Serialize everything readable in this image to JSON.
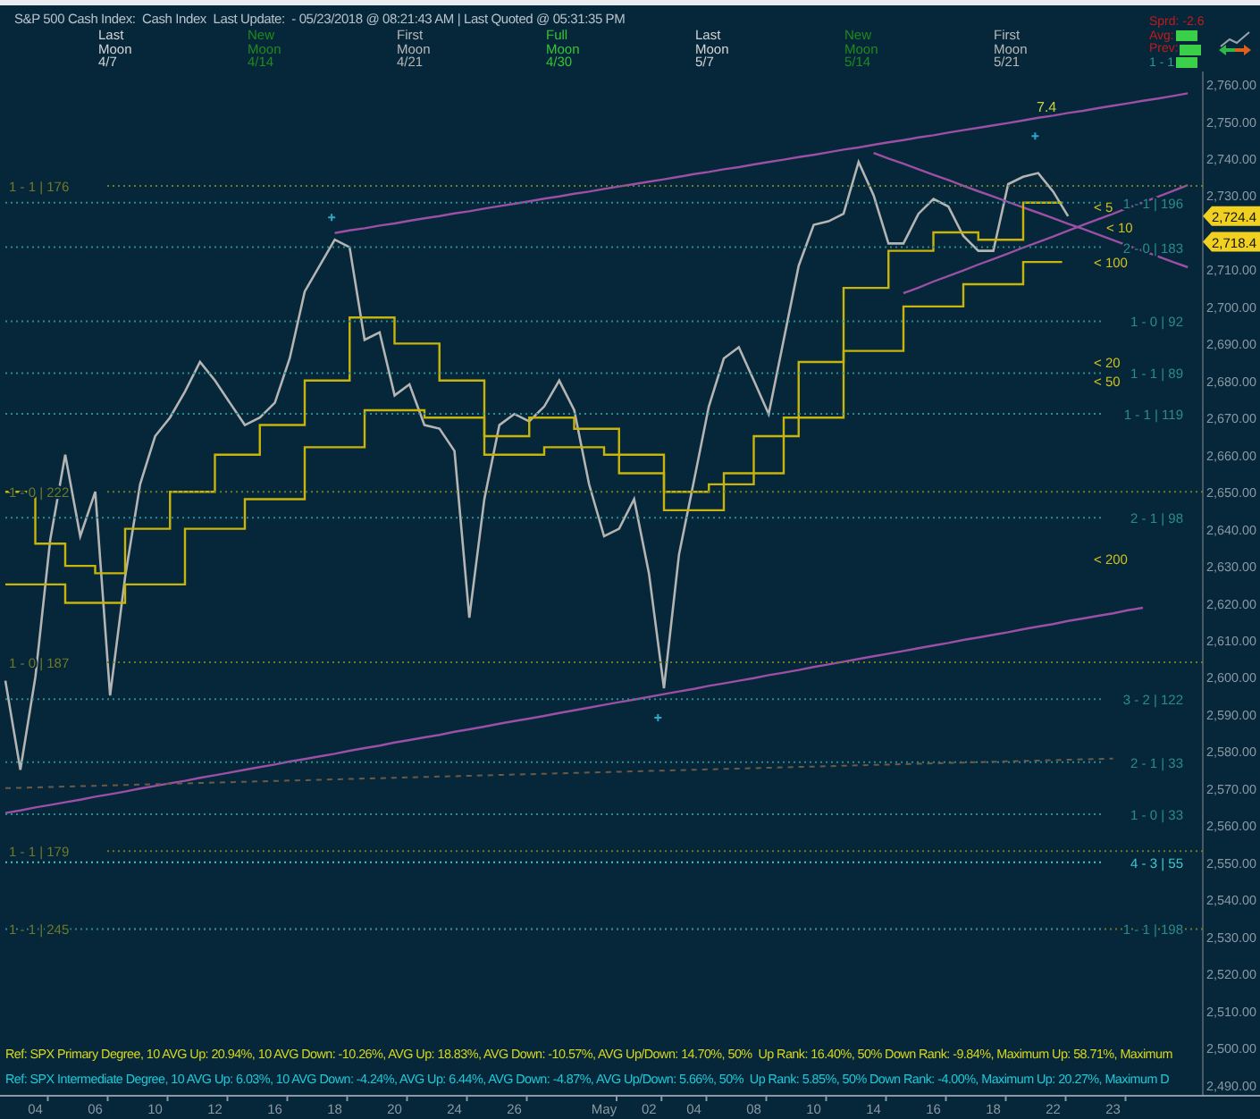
{
  "header": {
    "title": "S&P 500 Cash Index:  Cash Index  Last Update:  - 05/23/2018 @ 08:21:43 AM | Last Quoted @ 05:31:35 PM",
    "moon_phases": [
      {
        "line_1": "Last",
        "line_2": "Moon",
        "date": "4/7",
        "color": "#d4d4d4"
      },
      {
        "line_1": "New",
        "line_2": "Moon",
        "date": "4/14",
        "color": "#1f8a1f"
      },
      {
        "line_1": "First",
        "line_2": "Moon",
        "date": "4/21",
        "color": "#b8b8b8"
      },
      {
        "line_1": "Full",
        "line_2": "Moon",
        "date": "4/30",
        "color": "#36c436"
      },
      {
        "line_1": "Last",
        "line_2": "Moon",
        "date": "5/7",
        "color": "#d4d4d4"
      },
      {
        "line_1": "New",
        "line_2": "Moon",
        "date": "5/14",
        "color": "#1f8a1f"
      },
      {
        "line_1": "First",
        "line_2": "Moon",
        "date": "5/21",
        "color": "#b8b8b8"
      }
    ],
    "quote_box": [
      {
        "label": "Sprd: -2.6",
        "color": "#c41a1a",
        "badge": false
      },
      {
        "label": "Avg:",
        "color": "#c41a1a",
        "badge": true
      },
      {
        "label": "Prev:",
        "color": "#c41a1a",
        "badge": true
      },
      {
        "label": "1 - 1",
        "color": "#2a9a9a",
        "badge": true
      }
    ]
  },
  "chart": {
    "chart_data": {
      "type": "line",
      "categories": [
        null,
        null,
        "04",
        null,
        null,
        null,
        "06",
        null,
        null,
        null,
        "10",
        null,
        null,
        null,
        "12",
        null,
        null,
        null,
        "16",
        null,
        null,
        null,
        "18",
        null,
        null,
        null,
        "20",
        null,
        null,
        null,
        "24",
        null,
        null,
        null,
        "26",
        null,
        null,
        null,
        null,
        null,
        "May",
        null,
        null,
        "02",
        null,
        null,
        "04",
        null,
        null,
        null,
        "08",
        null,
        null,
        null,
        "10",
        null,
        null,
        null,
        "14",
        null,
        null,
        null,
        "16",
        null,
        null,
        null,
        "18",
        null,
        null,
        null,
        "22",
        null,
        null,
        null,
        "23",
        null,
        null,
        null,
        null,
        null
      ],
      "series": [
        {
          "color": "#b4b4b4",
          "values": [
            2599,
            2575,
            2600,
            2637,
            2660,
            2638,
            2650,
            2595,
            2627,
            2652,
            2665,
            2670,
            2677,
            2685,
            2680,
            2674,
            2668,
            2670,
            2674,
            2686,
            2704,
            2711,
            2718,
            2716,
            2691,
            2693,
            2676,
            2679,
            2668,
            2667,
            2661,
            2616,
            2648,
            2668,
            2671,
            2669,
            2673,
            2680,
            2672,
            2652,
            2638,
            2640,
            2648,
            2628,
            2597,
            2633,
            2653,
            2673,
            2686,
            2689,
            2680,
            2671,
            2691,
            2711,
            2722,
            2723,
            2725,
            2739,
            2730,
            2717,
            2717,
            2725,
            2729,
            2727,
            2719,
            2715,
            2715,
            2733,
            2735,
            2736,
            2731,
            2724.4,
            null,
            null,
            null,
            null,
            null,
            null,
            null,
            null
          ]
        },
        {
          "color": "#9b4fa5",
          "values": [
            null,
            null,
            null,
            null,
            null,
            null,
            null,
            null,
            null,
            null,
            null,
            null,
            null,
            null,
            null,
            null,
            null,
            null,
            null,
            null,
            null,
            null,
            2719.8,
            2720.5,
            2721.1,
            2721.8,
            2722.4,
            2723.1,
            2723.8,
            2724.4,
            2725.1,
            2725.7,
            2726.4,
            2727.1,
            2727.7,
            2728.4,
            2729.1,
            2729.7,
            2730.4,
            2731.0,
            2731.7,
            2732.4,
            2733.0,
            2733.7,
            2734.3,
            2735.0,
            2735.7,
            2736.3,
            2737.0,
            2737.6,
            2738.3,
            2739.0,
            2739.6,
            2740.3,
            2740.9,
            2741.6,
            2742.3,
            2742.9,
            2743.6,
            2744.3,
            2744.9,
            2745.6,
            2746.2,
            2746.9,
            2747.6,
            2748.2,
            2748.9,
            2749.5,
            2750.2,
            2750.9,
            2751.5,
            2752.2,
            2752.8,
            2753.5,
            2754.2,
            2754.8,
            2755.5,
            2756.1,
            2756.8,
            2757.5
          ]
        },
        {
          "color": "#9b4fa5",
          "values": [
            2563.3,
            2564.0,
            2564.8,
            2565.5,
            2566.2,
            2566.9,
            2567.7,
            2568.4,
            2569.1,
            2569.9,
            2570.6,
            2571.3,
            2572.0,
            2572.8,
            2573.5,
            2574.2,
            2575.0,
            2575.7,
            2576.4,
            2577.2,
            2577.9,
            2578.6,
            2579.3,
            2580.1,
            2580.8,
            2581.5,
            2582.3,
            2583.0,
            2583.7,
            2584.4,
            2585.2,
            2585.9,
            2586.6,
            2587.4,
            2588.1,
            2588.8,
            2589.5,
            2590.3,
            2591.0,
            2591.7,
            2592.5,
            2593.2,
            2593.9,
            2594.6,
            2595.4,
            2596.1,
            2596.8,
            2597.6,
            2598.3,
            2599.0,
            2599.7,
            2600.5,
            2601.2,
            2601.9,
            2602.7,
            2603.4,
            2604.1,
            2604.9,
            2605.6,
            2606.3,
            2607.0,
            2607.8,
            2608.5,
            2609.2,
            2610.0,
            2610.7,
            2611.4,
            2612.1,
            2612.9,
            2613.6,
            2614.3,
            2615.1,
            2615.8,
            2616.5,
            2617.2,
            2618.0,
            2618.7,
            null,
            null,
            null
          ]
        },
        {
          "color": "#9b4fa5",
          "values": [
            null,
            null,
            null,
            null,
            null,
            null,
            null,
            null,
            null,
            null,
            null,
            null,
            null,
            null,
            null,
            null,
            null,
            null,
            null,
            null,
            null,
            null,
            null,
            null,
            null,
            null,
            null,
            null,
            null,
            null,
            null,
            null,
            null,
            null,
            null,
            null,
            null,
            null,
            null,
            null,
            null,
            null,
            null,
            null,
            null,
            null,
            null,
            null,
            null,
            null,
            null,
            null,
            null,
            null,
            null,
            null,
            null,
            null,
            2741.4,
            2739.9,
            2738.5,
            2737.0,
            2735.5,
            2734.1,
            2732.6,
            2731.1,
            2729.7,
            2728.2,
            2726.7,
            2725.3,
            2723.8,
            2722.3,
            2720.9,
            2719.4,
            2717.9,
            2716.4,
            2715.0,
            2713.5,
            2712.0,
            2710.6
          ]
        },
        {
          "color": "#9b4fa5",
          "values": [
            null,
            null,
            null,
            null,
            null,
            null,
            null,
            null,
            null,
            null,
            null,
            null,
            null,
            null,
            null,
            null,
            null,
            null,
            null,
            null,
            null,
            null,
            null,
            null,
            null,
            null,
            null,
            null,
            null,
            null,
            null,
            null,
            null,
            null,
            null,
            null,
            null,
            null,
            null,
            null,
            null,
            null,
            null,
            null,
            null,
            null,
            null,
            null,
            null,
            null,
            null,
            null,
            null,
            null,
            null,
            null,
            null,
            null,
            null,
            null,
            2703.6,
            2705.1,
            2706.7,
            2708.2,
            2709.7,
            2711.3,
            2712.8,
            2714.3,
            2715.9,
            2717.4,
            2718.9,
            2720.4,
            2722.0,
            2723.5,
            2725.0,
            2726.6,
            2728.1,
            2729.6,
            2731.2,
            2732.7
          ]
        }
      ],
      "ylim": [
        2487,
        2763.4
      ],
      "yticks": [
        {
          "value": 2760,
          "label": "2,760.00"
        },
        {
          "value": 2750,
          "label": "2,750.00"
        },
        {
          "value": 2740,
          "label": "2,740.00"
        },
        {
          "value": 2730,
          "label": "2,730.00"
        },
        {
          "value": 2710,
          "label": "2,710.00"
        },
        {
          "value": 2700,
          "label": "2,700.00"
        },
        {
          "value": 2690,
          "label": "2,690.00"
        },
        {
          "value": 2680,
          "label": "2,680.00"
        },
        {
          "value": 2670,
          "label": "2,670.00"
        },
        {
          "value": 2660,
          "label": "2,660.00"
        },
        {
          "value": 2650,
          "label": "2,650.00"
        },
        {
          "value": 2640,
          "label": "2,640.00"
        },
        {
          "value": 2630,
          "label": "2,630.00"
        },
        {
          "value": 2620,
          "label": "2,620.00"
        },
        {
          "value": 2610,
          "label": "2,610.00"
        },
        {
          "value": 2600,
          "label": "2,600.00"
        },
        {
          "value": 2590,
          "label": "2,590.00"
        },
        {
          "value": 2580,
          "label": "2,580.00"
        },
        {
          "value": 2570,
          "label": "2,570.00"
        },
        {
          "value": 2560,
          "label": "2,560.00"
        },
        {
          "value": 2550,
          "label": "2,550.00"
        },
        {
          "value": 2540,
          "label": "2,540.00"
        },
        {
          "value": 2530,
          "label": "2,530.00"
        },
        {
          "value": 2520,
          "label": "2,520.00"
        },
        {
          "value": 2510,
          "label": "2,510.00"
        },
        {
          "value": 2500,
          "label": "2,500.00"
        },
        {
          "value": 2490,
          "label": "2,490.00"
        }
      ],
      "annotations": [
        "< 5",
        "< 10",
        "< 100",
        "< 20",
        "< 50",
        "< 200",
        "7.4"
      ]
    },
    "level_labels": [
      {
        "text": "1 - 1 | 176",
        "color": "#6e7a28"
      },
      {
        "text": "1 - 0 | 222",
        "color": "#6e7a28"
      },
      {
        "text": "1 - 0 | 187",
        "color": "#6e7a28"
      },
      {
        "text": "1 - 1 | 179",
        "color": "#6e7a28"
      },
      {
        "text": "1 - 1 | 245",
        "color": "#6e7a28"
      },
      {
        "text": "1 - 1 | 196",
        "color": "#2a8c8c"
      },
      {
        "text": "2 - 0 | 183",
        "color": "#2a8c8c"
      },
      {
        "text": "1 - 0 | 92",
        "color": "#2a8c8c"
      },
      {
        "text": "1 - 1 | 89",
        "color": "#2a8c8c"
      },
      {
        "text": "1 - 1 | 119",
        "color": "#2a8c8c"
      },
      {
        "text": "2 - 1 | 98",
        "color": "#2a8c8c"
      },
      {
        "text": "3 - 2 | 122",
        "color": "#2a8c8c"
      },
      {
        "text": "2 - 1 | 33",
        "color": "#2a8c8c"
      },
      {
        "text": "1 - 0 | 33",
        "color": "#2a8c8c"
      },
      {
        "text": "4 - 3 | 55",
        "color": "#40c8d0"
      },
      {
        "text": "1 - 1 | 198",
        "color": "#2a8c8c"
      }
    ],
    "price_tags": [
      "2,724.4",
      "2,718.4"
    ],
    "stats": [
      {
        "text": "Ref: SPX Primary Degree, 10 AVG Up: 20.94%, 10 AVG Down: -10.26%, AVG Up: 18.83%, AVG Down: -10.57%, AVG Up/Down: 14.70%, 50%  Up Rank: 16.40%, 50% Down Rank: -9.84%, Maximum Up: 58.71%, Maximum",
        "color": "#d6d61e"
      },
      {
        "text": "Ref: SPX Intermediate Degree, 10 AVG Up: 6.03%, 10 AVG Down: -4.24%, AVG Up: 6.44%, AVG Down: -4.87%, AVG Up/Down: 5.66%, 50%  Up Rank: 5.85%, 50% Down Rank: -4.00%, Maximum Up: 20.27%, Maximum D",
        "color": "#1ec8d8"
      }
    ]
  }
}
